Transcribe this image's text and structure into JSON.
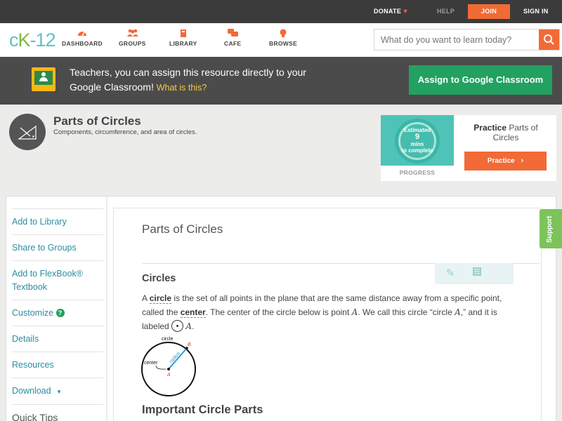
{
  "topbar": {
    "donate": "DONATE",
    "help": "HELP",
    "join": "JOIN",
    "signin": "SIGN IN"
  },
  "nav": {
    "logo_c": "c",
    "logo_k": "K",
    "logo_rest": "-12",
    "items": [
      {
        "label": "DASHBOARD",
        "icon": "gauge-icon"
      },
      {
        "label": "GROUPS",
        "icon": "groups-icon"
      },
      {
        "label": "LIBRARY",
        "icon": "library-icon"
      },
      {
        "label": "CAFE",
        "icon": "chat-bubbles-icon"
      },
      {
        "label": "BROWSE",
        "icon": "lightbulb-icon"
      }
    ],
    "search_placeholder": "What do you want to learn today?"
  },
  "banner": {
    "text": "Teachers, you can assign this resource directly to your Google Classroom!",
    "what_link": "What is this?",
    "assign_button": "Assign to Google Classroom"
  },
  "concept": {
    "title": "Parts of Circles",
    "subtitle": "Components, circumference, and area of circles.",
    "progress": {
      "estimated_line1": "Estimated",
      "minutes": "9",
      "estimated_line2": "mins",
      "estimated_line3": "to complete",
      "label": "PROGRESS"
    },
    "practice": {
      "title_bold": "Practice",
      "title_rest": "Parts of Circles",
      "button": "Practice"
    }
  },
  "sidebar": {
    "items": [
      {
        "label": "Add to Library"
      },
      {
        "label": "Share to Groups"
      },
      {
        "label": "Add to FlexBook® Textbook"
      },
      {
        "label": "Customize"
      },
      {
        "label": "Details"
      },
      {
        "label": "Resources"
      },
      {
        "label": "Download"
      },
      {
        "label": "Quick Tips"
      }
    ]
  },
  "article": {
    "title": "Parts of Circles",
    "section_heading": "Circles",
    "para": {
      "p1": "A ",
      "circle": "circle",
      "p2": " is the set of all points in the plane that are the same distance away from a specific point, called the ",
      "center": "center",
      "p3": ". The center of the circle below is point ",
      "A": "A",
      "p4": ". We call this circle “circle ",
      "p5": ",” and it is labeled ",
      "p6": "."
    },
    "diagram": {
      "circle_label": "circle",
      "radius_label": "radius",
      "center_label": "center",
      "point_a": "A",
      "point_b": "B"
    },
    "next_heading": "Important Circle Parts"
  },
  "support": "Support",
  "colors": {
    "accent_orange": "#f26a36",
    "link_teal": "#2b8da1",
    "assign_green": "#22a160",
    "support_green": "#7cc45a"
  }
}
